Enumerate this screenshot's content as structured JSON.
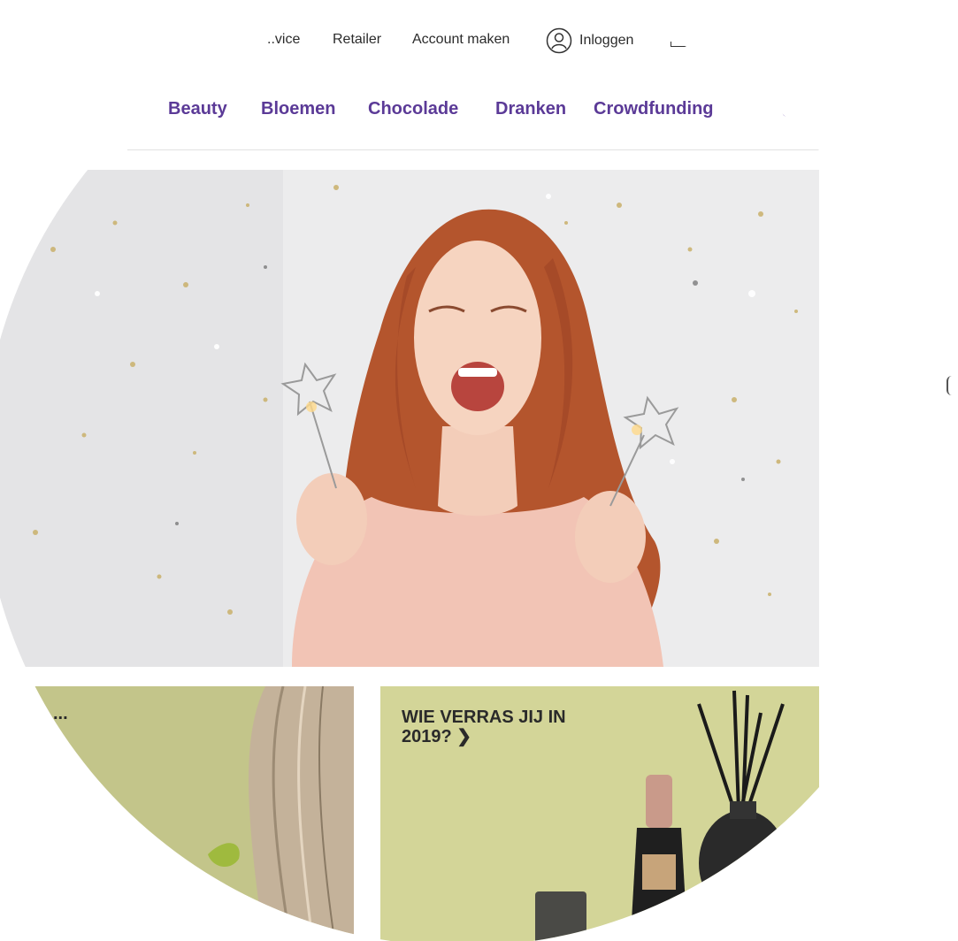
{
  "topbar": {
    "service_label": "..vice",
    "retailer_label": "Retailer",
    "account_label": "Account maken",
    "login_label": "Inloggen",
    "login_icon": "user-circle-icon",
    "cart_icon": "cart-icon"
  },
  "nav": {
    "items": [
      "Beauty",
      "Bloemen",
      "Chocolade",
      "Dranken",
      "Crowdfunding"
    ],
    "search_icon": "search-icon",
    "accent_color": "#5b3a97"
  },
  "tiles": {
    "right_title": "WIE VERRAS JIJ IN 2019? ❯",
    "left_title": "..."
  }
}
